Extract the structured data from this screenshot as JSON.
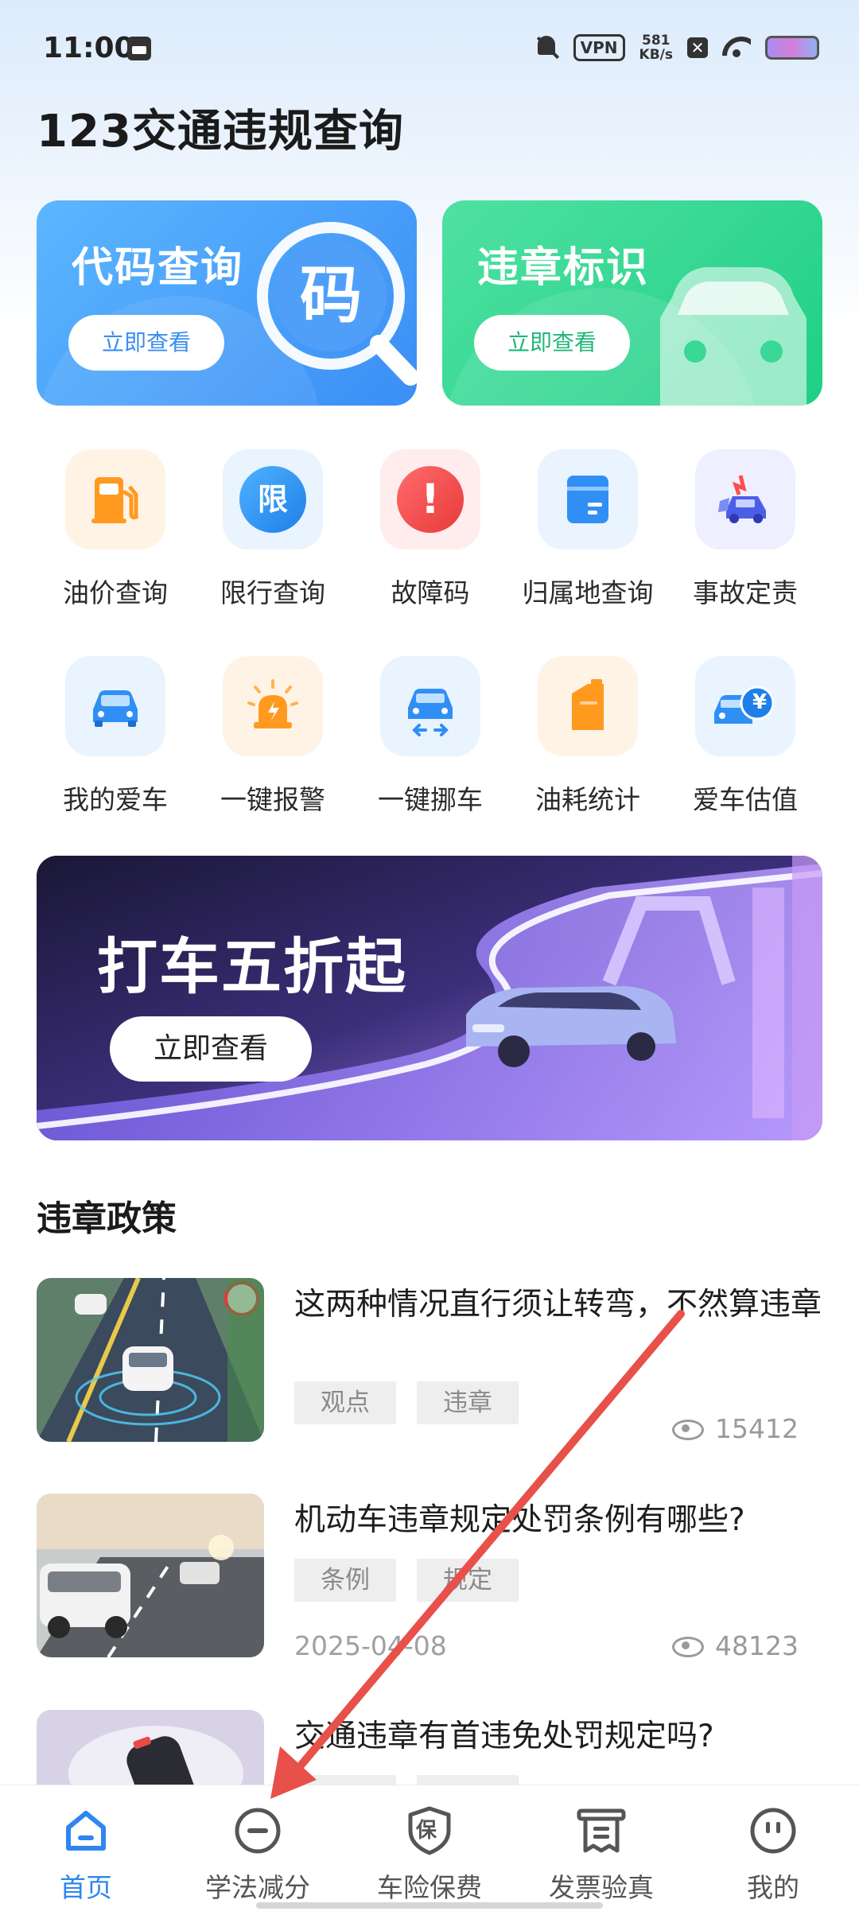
{
  "status_bar": {
    "time": "11:00",
    "vpn": "VPN",
    "speed_value": "581",
    "speed_unit": "KB/s"
  },
  "app": {
    "title": "123交通违规查询"
  },
  "cards": [
    {
      "title": "代码查询",
      "button": "立即查看",
      "badge": "码"
    },
    {
      "title": "违章标识",
      "button": "立即查看"
    }
  ],
  "grid": [
    {
      "label": "油价查询",
      "icon": "fuel-pump-icon"
    },
    {
      "label": "限行查询",
      "icon": "restriction-icon",
      "icon_text": "限"
    },
    {
      "label": "故障码",
      "icon": "warning-icon",
      "icon_text": "!"
    },
    {
      "label": "归属地查询",
      "icon": "location-book-icon"
    },
    {
      "label": "事故定责",
      "icon": "car-accident-icon"
    },
    {
      "label": "我的爱车",
      "icon": "my-car-icon"
    },
    {
      "label": "一键报警",
      "icon": "alarm-light-icon"
    },
    {
      "label": "一键挪车",
      "icon": "move-car-icon"
    },
    {
      "label": "油耗统计",
      "icon": "fuel-can-icon"
    },
    {
      "label": "爱车估值",
      "icon": "car-value-icon",
      "icon_text": "¥"
    }
  ],
  "banner": {
    "title": "打车五折起",
    "button": "立即查看"
  },
  "section": {
    "title": "违章政策"
  },
  "news": [
    {
      "title": "这两种情况直行须让转弯，不然算违章",
      "tags": [
        "观点",
        "违章"
      ],
      "date": "",
      "views": "15412"
    },
    {
      "title": "机动车违章规定处罚条例有哪些?",
      "tags": [
        "条例",
        "规定"
      ],
      "date": "2025-04-08",
      "views": "48123"
    },
    {
      "title": "交通违章有首违免处罚规定吗?",
      "tags": [
        "",
        ""
      ],
      "date": "",
      "views": ""
    }
  ],
  "nav": [
    {
      "label": "首页",
      "icon": "home-icon",
      "active": true
    },
    {
      "label": "学法减分",
      "icon": "minus-circle-icon",
      "active": false
    },
    {
      "label": "车险保费",
      "icon": "insurance-shield-icon",
      "icon_text": "保",
      "active": false
    },
    {
      "label": "发票验真",
      "icon": "invoice-icon",
      "active": false
    },
    {
      "label": "我的",
      "icon": "profile-icon",
      "active": false
    }
  ],
  "colors": {
    "accent": "#2f86f0",
    "green": "#1fcf86",
    "annotation": "#e8504a"
  }
}
